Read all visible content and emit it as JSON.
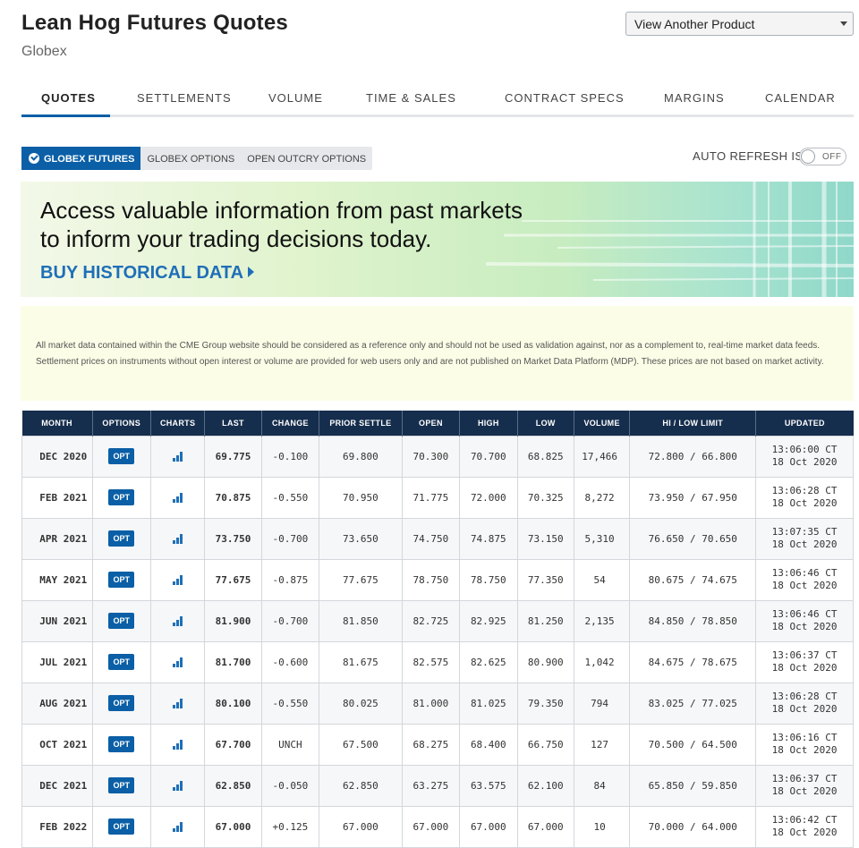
{
  "header": {
    "title": "Lean Hog Futures Quotes",
    "subtitle": "Globex",
    "product_select": "View Another Product"
  },
  "tabs": [
    "QUOTES",
    "SETTLEMENTS",
    "VOLUME",
    "TIME & SALES",
    "CONTRACT SPECS",
    "MARGINS",
    "CALENDAR"
  ],
  "segments": [
    "GLOBEX FUTURES",
    "GLOBEX OPTIONS",
    "OPEN OUTCRY OPTIONS"
  ],
  "auto_refresh": {
    "label": "AUTO REFRESH IS",
    "state": "OFF"
  },
  "banner": {
    "line1": "Access valuable information from past markets",
    "line2": "to inform your trading decisions today.",
    "cta": "BUY HISTORICAL DATA"
  },
  "disclaimer": "All market data contained within the CME Group website should be considered as a reference only and should not be used as validation against, nor as a complement to, real-time market data feeds. Settlement prices on instruments without open interest or volume are provided for web users only and are not published on Market Data Platform (MDP). These prices are not based on market activity.",
  "table": {
    "headers": [
      "MONTH",
      "OPTIONS",
      "CHARTS",
      "LAST",
      "CHANGE",
      "PRIOR SETTLE",
      "OPEN",
      "HIGH",
      "LOW",
      "VOLUME",
      "HI / LOW LIMIT",
      "UPDATED"
    ],
    "opt_label": "OPT",
    "rows": [
      {
        "month": "DEC 2020",
        "last": "69.775",
        "change": "-0.100",
        "dir": "neg",
        "prior": "69.800",
        "open": "70.300",
        "high": "70.700",
        "low": "68.825",
        "volume": "17,466",
        "limit": "72.800 / 66.800",
        "time": "13:06:00 CT",
        "date": "18 Oct 2020"
      },
      {
        "month": "FEB 2021",
        "last": "70.875",
        "change": "-0.550",
        "dir": "neg",
        "prior": "70.950",
        "open": "71.775",
        "high": "72.000",
        "low": "70.325",
        "volume": "8,272",
        "limit": "73.950 / 67.950",
        "time": "13:06:28 CT",
        "date": "18 Oct 2020"
      },
      {
        "month": "APR 2021",
        "last": "73.750",
        "change": "-0.700",
        "dir": "neg",
        "prior": "73.650",
        "open": "74.750",
        "high": "74.875",
        "low": "73.150",
        "volume": "5,310",
        "limit": "76.650 / 70.650",
        "time": "13:07:35 CT",
        "date": "18 Oct 2020"
      },
      {
        "month": "MAY 2021",
        "last": "77.675",
        "change": "-0.875",
        "dir": "neg",
        "prior": "77.675",
        "open": "78.750",
        "high": "78.750",
        "low": "77.350",
        "volume": "54",
        "limit": "80.675 / 74.675",
        "time": "13:06:46 CT",
        "date": "18 Oct 2020"
      },
      {
        "month": "JUN 2021",
        "last": "81.900",
        "change": "-0.700",
        "dir": "neg",
        "prior": "81.850",
        "open": "82.725",
        "high": "82.925",
        "low": "81.250",
        "volume": "2,135",
        "limit": "84.850 / 78.850",
        "time": "13:06:46 CT",
        "date": "18 Oct 2020"
      },
      {
        "month": "JUL 2021",
        "last": "81.700",
        "change": "-0.600",
        "dir": "neg",
        "prior": "81.675",
        "open": "82.575",
        "high": "82.625",
        "low": "80.900",
        "volume": "1,042",
        "limit": "84.675 / 78.675",
        "time": "13:06:37 CT",
        "date": "18 Oct 2020"
      },
      {
        "month": "AUG 2021",
        "last": "80.100",
        "change": "-0.550",
        "dir": "neg",
        "prior": "80.025",
        "open": "81.000",
        "high": "81.025",
        "low": "79.350",
        "volume": "794",
        "limit": "83.025 / 77.025",
        "time": "13:06:28 CT",
        "date": "18 Oct 2020"
      },
      {
        "month": "OCT 2021",
        "last": "67.700",
        "change": "UNCH",
        "dir": "unch",
        "prior": "67.500",
        "open": "68.275",
        "high": "68.400",
        "low": "66.750",
        "volume": "127",
        "limit": "70.500 / 64.500",
        "time": "13:06:16 CT",
        "date": "18 Oct 2020"
      },
      {
        "month": "DEC 2021",
        "last": "62.850",
        "change": "-0.050",
        "dir": "neg",
        "prior": "62.850",
        "open": "63.275",
        "high": "63.575",
        "low": "62.100",
        "volume": "84",
        "limit": "65.850 / 59.850",
        "time": "13:06:37 CT",
        "date": "18 Oct 2020"
      },
      {
        "month": "FEB 2022",
        "last": "67.000",
        "change": "+0.125",
        "dir": "pos",
        "prior": "67.000",
        "open": "67.000",
        "high": "67.000",
        "low": "67.000",
        "volume": "10",
        "limit": "70.000 / 64.000",
        "time": "13:06:42 CT",
        "date": "18 Oct 2020"
      }
    ]
  },
  "colors": {
    "accent": "#0a5fa6",
    "header_bg": "#162e4d",
    "negative": "#e21b1b",
    "positive": "#1b8a2a"
  }
}
